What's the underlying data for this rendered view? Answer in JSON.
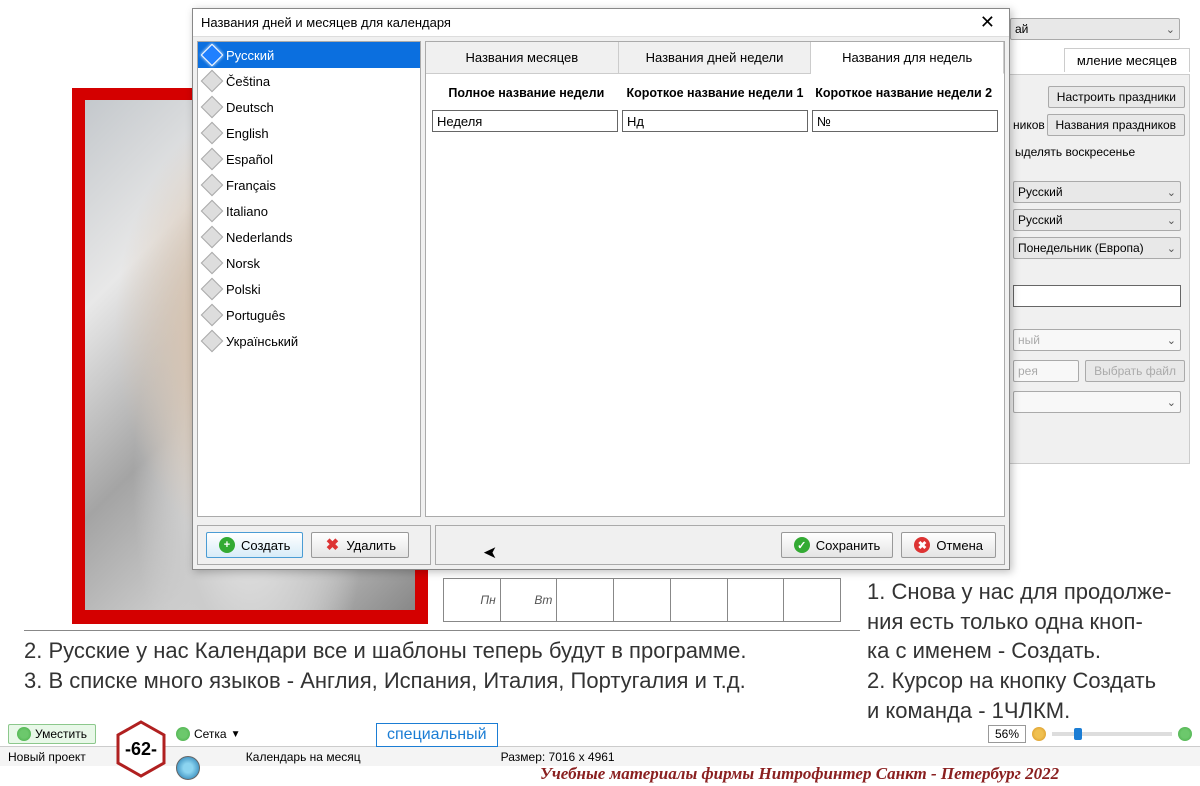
{
  "dialog": {
    "title": "Названия дней и месяцев для календаря",
    "languages": [
      "Русский",
      "Čeština",
      "Deutsch",
      "English",
      "Español",
      "Français",
      "Italiano",
      "Nederlands",
      "Norsk",
      "Polski",
      "Português",
      "Український"
    ],
    "selected_language_index": 0,
    "tabs": [
      "Названия месяцев",
      "Названия дней недели",
      "Названия для недель"
    ],
    "active_tab_index": 2,
    "columns": [
      "Полное название недели",
      "Короткое название недели 1",
      "Короткое название недели 2"
    ],
    "row": {
      "full": "Неделя",
      "short1": "Нд",
      "short2": "№"
    },
    "buttons": {
      "create": "Создать",
      "delete": "Удалить",
      "save": "Сохранить",
      "cancel": "Отмена"
    }
  },
  "side": {
    "top_dropdown": "ай",
    "tab": "мление месяцев",
    "btn_holidays_setup": "Настроить праздники",
    "label_nikov": "ников",
    "btn_holiday_names": "Названия праздников",
    "chk_sunday": "ыделять воскресенье",
    "dd1": "Русский",
    "dd2": "Русский",
    "dd3": "Понедельник (Европа)",
    "dd_disabled1": "ный",
    "dd_disabled2": "рея",
    "btn_select_file": "Выбрать файл"
  },
  "calendar_days": [
    "Пн",
    "Вт",
    "",
    "",
    "",
    "",
    ""
  ],
  "instructions_left": [
    "2. Русские у нас Календари все и шаблоны теперь будут в программе.",
    "3. В списке много языков - Англия, Испания, Италия, Португалия и т.д."
  ],
  "instructions_right": [
    "1. Снова у нас для продолже-",
    "ния есть только одна кноп-",
    "ка с именем - Создать.",
    "2. Курсор на кнопку Создать",
    "и команда - 1ЧЛКМ."
  ],
  "bottom": {
    "fit": "Уместить",
    "grid": "Сетка",
    "zoom": "56%"
  },
  "status": {
    "new_project": "Новый проект",
    "cal_type": "Календарь на месяц",
    "size_label": "Размер: 7016 x 4961"
  },
  "special": "специальный",
  "badge": "-62-",
  "footer": "Учебные материалы фирмы Нитрофинтер  Санкт - Петербург  2022"
}
